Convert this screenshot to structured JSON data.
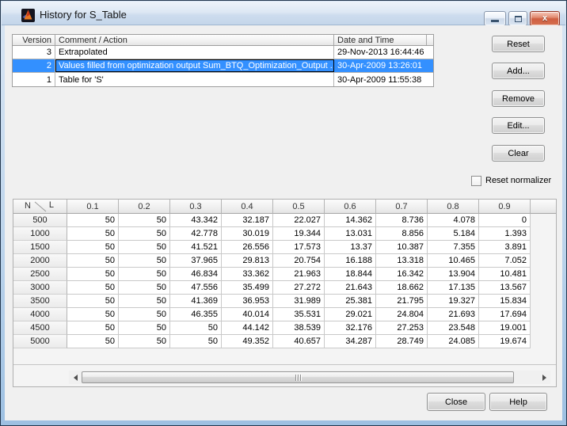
{
  "window": {
    "title": "History for S_Table",
    "controls": {
      "close_glyph": "x"
    }
  },
  "history": {
    "columns": {
      "version": "Version",
      "comment": "Comment / Action",
      "date": "Date and Time"
    },
    "rows": [
      {
        "version": "3",
        "comment": "Extrapolated",
        "date": "29-Nov-2013 16:44:46",
        "selected": false
      },
      {
        "version": "2",
        "comment": "Values filled from optimization output Sum_BTQ_Optimization_Output ...",
        "date": "30-Apr-2009 13:26:01",
        "selected": true
      },
      {
        "version": "1",
        "comment": "Table for 'S'",
        "date": "30-Apr-2009 11:55:38",
        "selected": false
      }
    ]
  },
  "actions": {
    "reset": "Reset",
    "add": "Add...",
    "remove": "Remove",
    "edit": "Edit...",
    "clear": "Clear"
  },
  "reset_normalizer": {
    "label": "Reset normalizer",
    "checked": false
  },
  "data_table": {
    "corner": {
      "row_axis": "N",
      "col_axis": "L"
    },
    "columns": [
      "0.1",
      "0.2",
      "0.3",
      "0.4",
      "0.5",
      "0.6",
      "0.7",
      "0.8",
      "0.9"
    ],
    "rows": [
      {
        "n": "500",
        "values": [
          "50",
          "50",
          "43.342",
          "32.187",
          "22.027",
          "14.362",
          "8.736",
          "4.078",
          "0"
        ]
      },
      {
        "n": "1000",
        "values": [
          "50",
          "50",
          "42.778",
          "30.019",
          "19.344",
          "13.031",
          "8.856",
          "5.184",
          "1.393"
        ]
      },
      {
        "n": "1500",
        "values": [
          "50",
          "50",
          "41.521",
          "26.556",
          "17.573",
          "13.37",
          "10.387",
          "7.355",
          "3.891"
        ]
      },
      {
        "n": "2000",
        "values": [
          "50",
          "50",
          "37.965",
          "29.813",
          "20.754",
          "16.188",
          "13.318",
          "10.465",
          "7.052"
        ]
      },
      {
        "n": "2500",
        "values": [
          "50",
          "50",
          "46.834",
          "33.362",
          "21.963",
          "18.844",
          "16.342",
          "13.904",
          "10.481"
        ]
      },
      {
        "n": "3000",
        "values": [
          "50",
          "50",
          "47.556",
          "35.499",
          "27.272",
          "21.643",
          "18.662",
          "17.135",
          "13.567"
        ]
      },
      {
        "n": "3500",
        "values": [
          "50",
          "50",
          "41.369",
          "36.953",
          "31.989",
          "25.381",
          "21.795",
          "19.327",
          "15.834"
        ]
      },
      {
        "n": "4000",
        "values": [
          "50",
          "50",
          "46.355",
          "40.014",
          "35.531",
          "29.021",
          "24.804",
          "21.693",
          "17.694"
        ]
      },
      {
        "n": "4500",
        "values": [
          "50",
          "50",
          "50",
          "44.142",
          "38.539",
          "32.176",
          "27.253",
          "23.548",
          "19.001"
        ]
      },
      {
        "n": "5000",
        "values": [
          "50",
          "50",
          "50",
          "49.352",
          "40.657",
          "34.287",
          "28.749",
          "24.085",
          "19.674"
        ]
      }
    ]
  },
  "footer": {
    "close": "Close",
    "help": "Help"
  },
  "colors": {
    "selection": "#3390ff",
    "close_button_border": "#93301c"
  }
}
